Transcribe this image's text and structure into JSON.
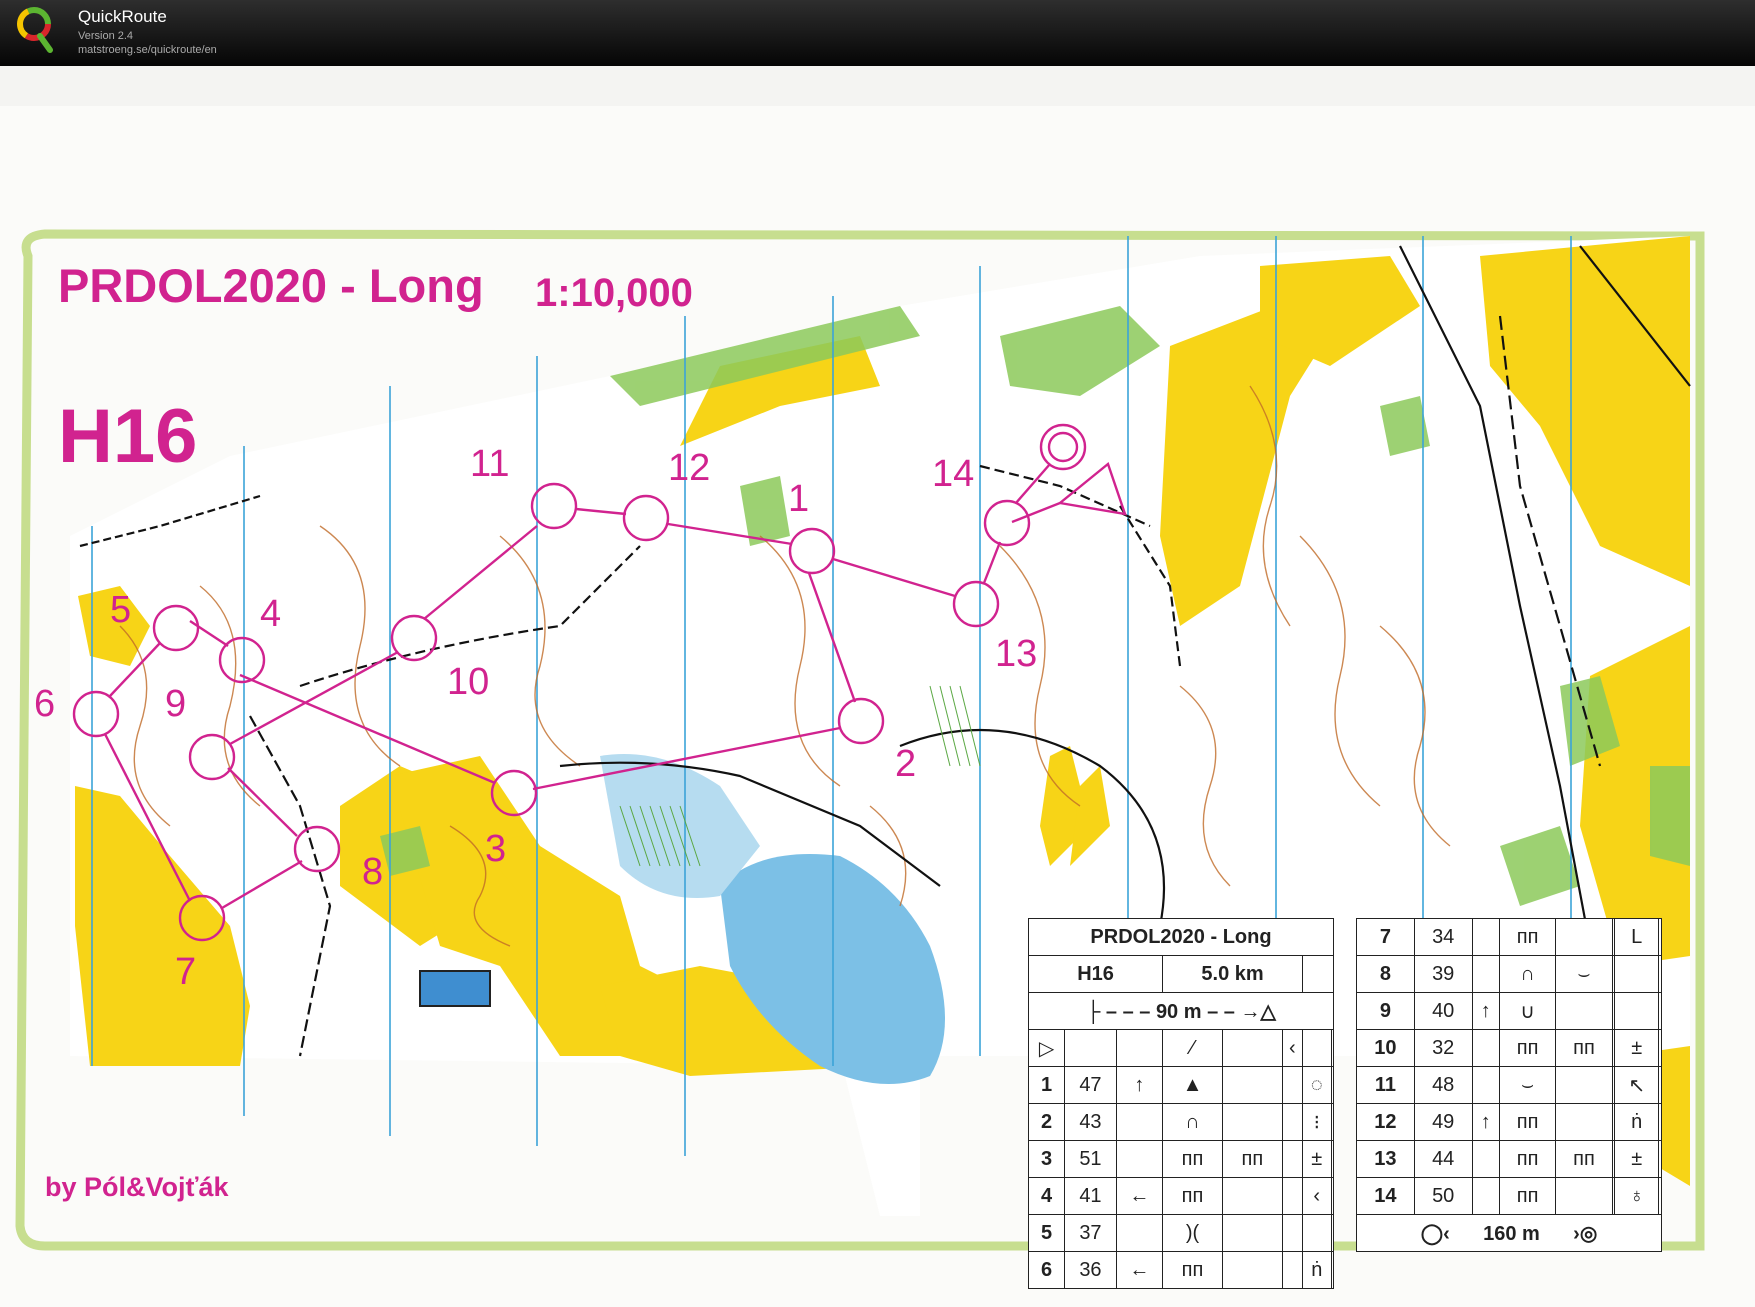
{
  "app": {
    "title": "QuickRoute",
    "version": "Version 2.4",
    "url": "matstroeng.se/quickroute/en"
  },
  "map": {
    "event_title": "PRDOL2020 - Long",
    "scale": "1:10,000",
    "category": "H16",
    "credit": "by Pól&Vojťák",
    "course_color": "#d1238f",
    "colors": {
      "open": "#f7d417",
      "forest_green": "#7fc24a",
      "water": "#7cc0e6",
      "border": "#c7de8f"
    },
    "control_labels": [
      "1",
      "2",
      "3",
      "4",
      "5",
      "6",
      "7",
      "8",
      "9",
      "10",
      "11",
      "12",
      "13",
      "14"
    ]
  },
  "control_description": {
    "title": "PRDOL2020 - Long",
    "class": "H16",
    "length": "5.0 km",
    "start_to_first": "90 m",
    "finish_distance": "160 m",
    "rows": [
      {
        "n": "1",
        "code": "47",
        "dir": "↑",
        "feature": "▲",
        "size": "",
        "loc": "◌"
      },
      {
        "n": "2",
        "code": "43",
        "dir": "",
        "feature": "∩",
        "size": "",
        "loc": "⁝"
      },
      {
        "n": "3",
        "code": "51",
        "dir": "",
        "feature": "ᴨᴨ",
        "size": "ᴨᴨ",
        "loc": "±"
      },
      {
        "n": "4",
        "code": "41",
        "dir": "←",
        "feature": "ᴨᴨ",
        "size": "",
        "loc": "‹"
      },
      {
        "n": "5",
        "code": "37",
        "dir": "",
        "feature": ")(",
        "size": "",
        "loc": ""
      },
      {
        "n": "6",
        "code": "36",
        "dir": "←",
        "feature": "ᴨᴨ",
        "size": "",
        "loc": "ṅ"
      },
      {
        "n": "7",
        "code": "34",
        "dir": "",
        "feature": "ᴨᴨ",
        "size": "",
        "loc": "L"
      },
      {
        "n": "8",
        "code": "39",
        "dir": "",
        "feature": "∩",
        "size": "⌣",
        "loc": ""
      },
      {
        "n": "9",
        "code": "40",
        "dir": "↑",
        "feature": "∪",
        "size": "",
        "loc": ""
      },
      {
        "n": "10",
        "code": "32",
        "dir": "",
        "feature": "ᴨᴨ",
        "size": "ᴨᴨ",
        "loc": "±"
      },
      {
        "n": "11",
        "code": "48",
        "dir": "",
        "feature": "⌣",
        "size": "",
        "loc": "↖"
      },
      {
        "n": "12",
        "code": "49",
        "dir": "↑",
        "feature": "ᴨᴨ",
        "size": "",
        "loc": "ṅ"
      },
      {
        "n": "13",
        "code": "44",
        "dir": "",
        "feature": "ᴨᴨ",
        "size": "ᴨᴨ",
        "loc": "±"
      },
      {
        "n": "14",
        "code": "50",
        "dir": "",
        "feature": "ᴨᴨ",
        "size": "",
        "loc": "♁"
      }
    ]
  }
}
